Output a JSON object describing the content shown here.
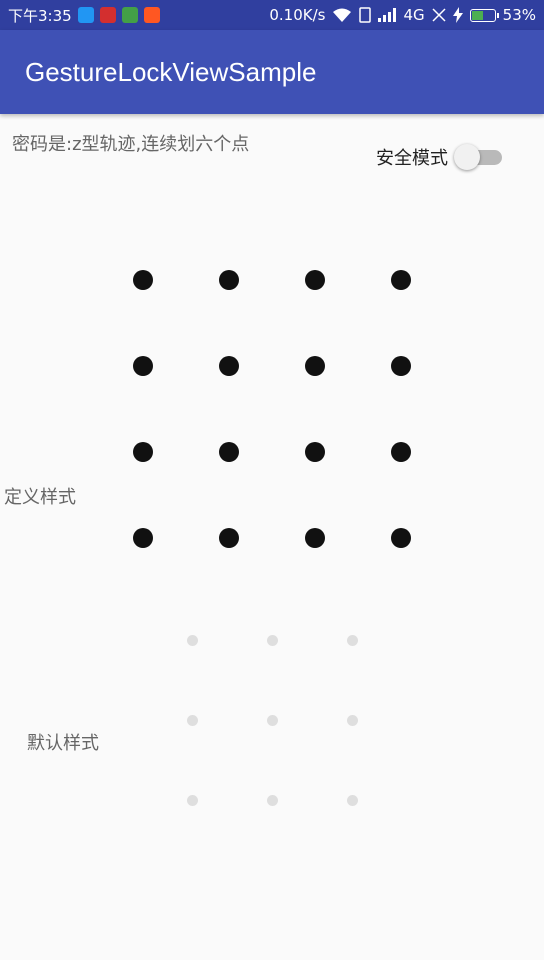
{
  "status_bar": {
    "time": "下午3:35",
    "network_speed": "0.10K/s",
    "network_type": "4G",
    "battery_percent": "53%",
    "battery_level": 0.53
  },
  "app_bar": {
    "title": "GestureLockViewSample"
  },
  "hint": "密码是:z型轨迹,连续划六个点",
  "secure_mode": {
    "label": "安全模式",
    "enabled": false
  },
  "custom_lock": {
    "label": "定义样式",
    "rows": 4,
    "cols": 4
  },
  "default_lock": {
    "label": "默认样式",
    "rows": 3,
    "cols": 3
  },
  "colors": {
    "primary": "#3f51b5",
    "primary_dark": "#303f9f",
    "dot_custom": "#111111",
    "dot_default": "#dedede"
  }
}
